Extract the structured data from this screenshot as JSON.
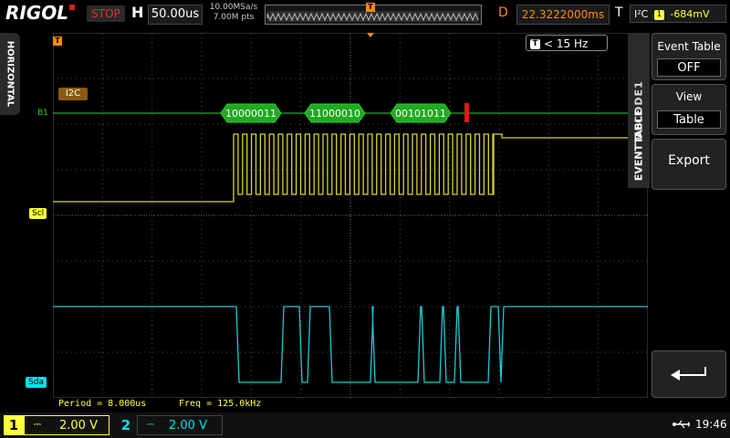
{
  "brand": "RIGOL",
  "top": {
    "run_state": "STOP",
    "h_label": "H",
    "timebase": "50.00us",
    "sample_rate": "10.00MSa/s",
    "mem_depth": "7.00M pts",
    "d_label": "D",
    "trigger_offset": "22.3222000ms",
    "t_label": "T",
    "trigger_source": "I²C",
    "trigger_channel": "1",
    "trigger_level": "-684mV"
  },
  "left_tab": "HORIZONTAL",
  "right_tab": "DECODE1",
  "menu": {
    "side_tab": "EVENTTABLE",
    "event_table_title": "Event Table",
    "event_table_value": "OFF",
    "view_title": "View",
    "view_value": "Table",
    "export_label": "Export"
  },
  "freq_badge": "< 15 Hz",
  "trigger_marker": "T",
  "bus": {
    "tag": "I2C",
    "marker": "B1",
    "packets": [
      "10000011",
      "11000010",
      "00101011"
    ]
  },
  "channels": {
    "scl_label": "Scl",
    "sda_label": "Sda",
    "ch1_num": "1",
    "ch1_coupling": "⎓",
    "ch1_scale": "2.00 V",
    "ch2_num": "2",
    "ch2_coupling": "⎓",
    "ch2_scale": "2.00 V"
  },
  "measurements": {
    "period": "Period = 8.000us",
    "freq": "Freq = 125.0kHz"
  },
  "status": {
    "usb": "⭠",
    "time": "19:46"
  },
  "colors": {
    "ch1": "#ffff3c",
    "ch2": "#00e4f0",
    "bus": "#2fd42f",
    "trigger": "#ff8c00"
  }
}
